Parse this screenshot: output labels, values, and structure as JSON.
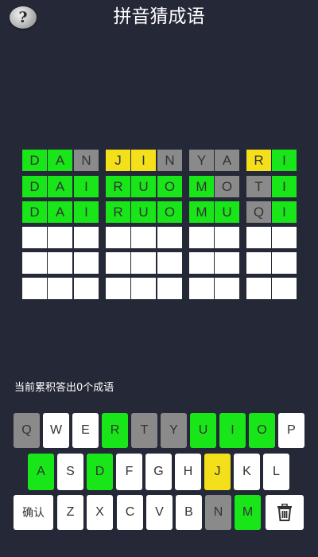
{
  "header": {
    "title": "拼音猜成语",
    "help_label": "?",
    "help_icon": "help-question-icon"
  },
  "colors": {
    "background": "#252837",
    "green": "#19e619",
    "yellow": "#f4e01a",
    "gray": "#8a8a8a",
    "white": "#ffffff"
  },
  "board": {
    "rows": [
      [
        [
          "D",
          "green"
        ],
        [
          "A",
          "green"
        ],
        [
          "N",
          "gray"
        ],
        [
          "J",
          "yellow"
        ],
        [
          "I",
          "yellow"
        ],
        [
          "N",
          "gray"
        ],
        [
          "Y",
          "gray"
        ],
        [
          "A",
          "gray"
        ],
        [
          "R",
          "yellow"
        ],
        [
          "I",
          "green"
        ]
      ],
      [
        [
          "D",
          "green"
        ],
        [
          "A",
          "green"
        ],
        [
          "I",
          "green"
        ],
        [
          "R",
          "green"
        ],
        [
          "U",
          "green"
        ],
        [
          "O",
          "green"
        ],
        [
          "M",
          "green"
        ],
        [
          "O",
          "gray"
        ],
        [
          "T",
          "gray"
        ],
        [
          "I",
          "green"
        ]
      ],
      [
        [
          "D",
          "green"
        ],
        [
          "A",
          "green"
        ],
        [
          "I",
          "green"
        ],
        [
          "R",
          "green"
        ],
        [
          "U",
          "green"
        ],
        [
          "O",
          "green"
        ],
        [
          "M",
          "green"
        ],
        [
          "U",
          "green"
        ],
        [
          "Q",
          "gray"
        ],
        [
          "I",
          "green"
        ]
      ],
      [
        [
          "",
          "empty"
        ],
        [
          "",
          "empty"
        ],
        [
          "",
          "empty"
        ],
        [
          "",
          "empty"
        ],
        [
          "",
          "empty"
        ],
        [
          "",
          "empty"
        ],
        [
          "",
          "empty"
        ],
        [
          "",
          "empty"
        ],
        [
          "",
          "empty"
        ],
        [
          "",
          "empty"
        ]
      ],
      [
        [
          "",
          "empty"
        ],
        [
          "",
          "empty"
        ],
        [
          "",
          "empty"
        ],
        [
          "",
          "empty"
        ],
        [
          "",
          "empty"
        ],
        [
          "",
          "empty"
        ],
        [
          "",
          "empty"
        ],
        [
          "",
          "empty"
        ],
        [
          "",
          "empty"
        ],
        [
          "",
          "empty"
        ]
      ],
      [
        [
          "",
          "empty"
        ],
        [
          "",
          "empty"
        ],
        [
          "",
          "empty"
        ],
        [
          "",
          "empty"
        ],
        [
          "",
          "empty"
        ],
        [
          "",
          "empty"
        ],
        [
          "",
          "empty"
        ],
        [
          "",
          "empty"
        ],
        [
          "",
          "empty"
        ],
        [
          "",
          "empty"
        ]
      ]
    ]
  },
  "status": {
    "text": "当前累积答出0个成语"
  },
  "keyboard": {
    "row1": [
      [
        "Q",
        "gray"
      ],
      [
        "W",
        "white"
      ],
      [
        "E",
        "white"
      ],
      [
        "R",
        "green"
      ],
      [
        "T",
        "gray"
      ],
      [
        "Y",
        "gray"
      ],
      [
        "U",
        "green"
      ],
      [
        "I",
        "green"
      ],
      [
        "O",
        "green"
      ],
      [
        "P",
        "white"
      ]
    ],
    "row2": [
      [
        "A",
        "green"
      ],
      [
        "S",
        "white"
      ],
      [
        "D",
        "green"
      ],
      [
        "F",
        "white"
      ],
      [
        "G",
        "white"
      ],
      [
        "H",
        "white"
      ],
      [
        "J",
        "yellow"
      ],
      [
        "K",
        "white"
      ],
      [
        "L",
        "white"
      ]
    ],
    "row3": [
      [
        "确认",
        "white"
      ],
      [
        "Z",
        "white"
      ],
      [
        "X",
        "white"
      ],
      [
        "C",
        "white"
      ],
      [
        "V",
        "white"
      ],
      [
        "B",
        "white"
      ],
      [
        "N",
        "gray"
      ],
      [
        "M",
        "green"
      ]
    ],
    "delete_icon": "trash-icon"
  }
}
